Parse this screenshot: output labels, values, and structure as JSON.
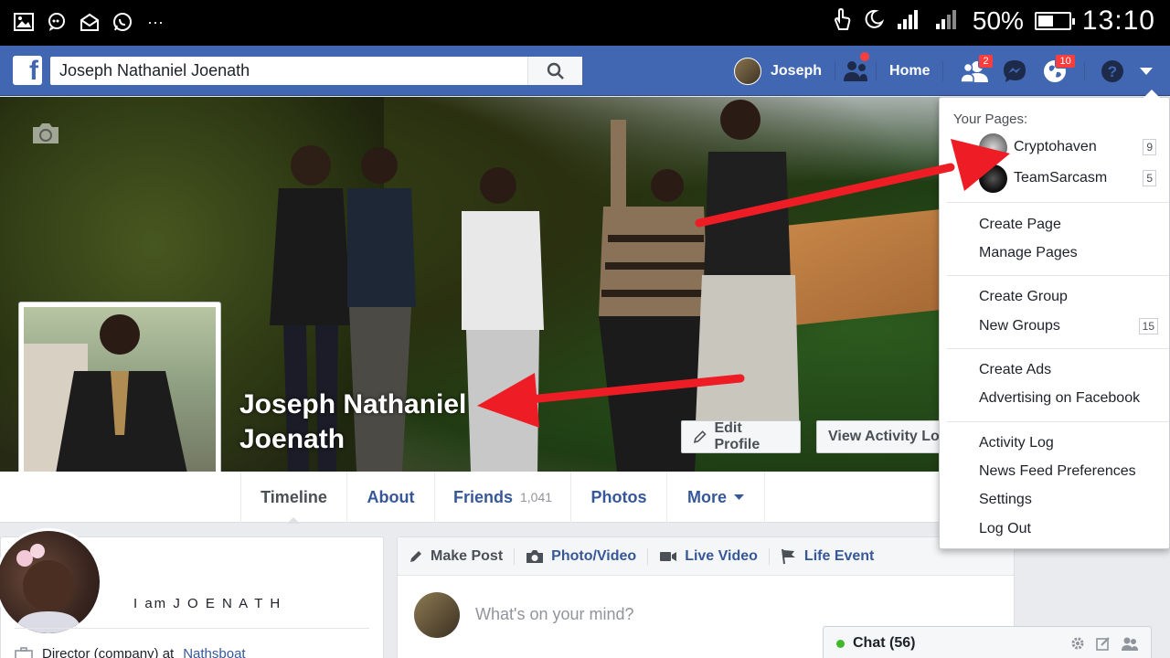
{
  "status_bar": {
    "battery_percent": "50%",
    "battery_level": 0.5,
    "time": "13:10",
    "icons": [
      "image-icon",
      "chat-bubble-icon",
      "mail-open-icon",
      "whatsapp-icon",
      "more-dots-icon",
      "touch-icon",
      "moon-icon",
      "signal-icon",
      "signal-icon"
    ]
  },
  "top_bar": {
    "brand_letter": "f",
    "search_value": "Joseph Nathaniel Joenath",
    "user_name": "Joseph",
    "home_label": "Home",
    "friend_requests_count": "2",
    "notifications_count": "10",
    "colors": {
      "bar": "#4267b2",
      "badge": "#fa3e3e"
    }
  },
  "cover": {
    "name_line1": "Joseph Nathaniel",
    "name_line2": "Joenath",
    "edit_profile_label": "Edit Profile",
    "view_activity_label": "View Activity Log"
  },
  "tabs": [
    {
      "label": "Timeline"
    },
    {
      "label": "About"
    },
    {
      "label": "Friends",
      "count": "1,041"
    },
    {
      "label": "Photos"
    },
    {
      "label": "More"
    }
  ],
  "intro": {
    "bio": "I am J O E N A T H",
    "work_prefix": "Director (company) at",
    "work_link": "Nathsboat"
  },
  "composer": {
    "tabs": [
      "Make Post",
      "Photo/Video",
      "Live Video",
      "Life Event"
    ],
    "placeholder": "What's on your mind?"
  },
  "chat": {
    "label": "Chat (56)"
  },
  "dropdown": {
    "title": "Your Pages:",
    "pages": [
      {
        "name": "Cryptohaven",
        "count": "9"
      },
      {
        "name": "TeamSarcasm",
        "count": "5"
      }
    ],
    "groups": [
      [
        "Create Page",
        "Manage Pages"
      ],
      [
        "Create Group",
        "New Groups"
      ],
      [
        "Create Ads",
        "Advertising on Facebook"
      ],
      [
        "Activity Log",
        "News Feed Preferences",
        "Settings",
        "Log Out"
      ]
    ],
    "new_groups_count": "15"
  }
}
